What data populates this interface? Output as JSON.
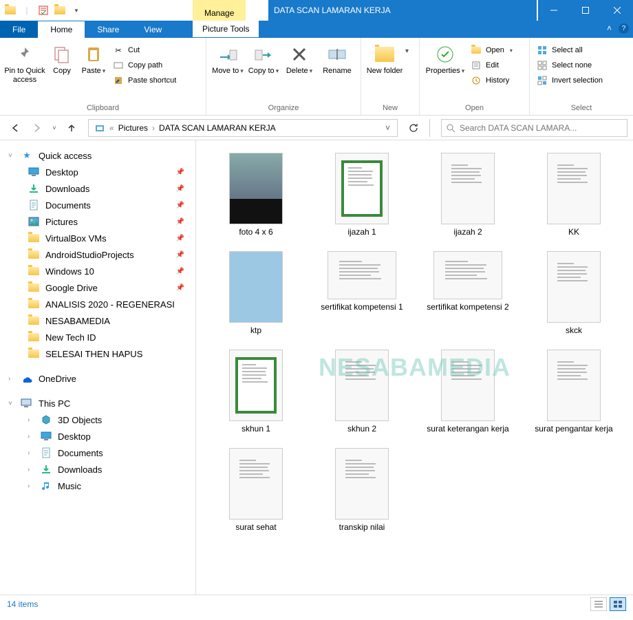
{
  "window": {
    "title": "DATA SCAN LAMARAN KERJA",
    "manage_tab": "Manage",
    "picture_tools": "Picture Tools"
  },
  "tabs": {
    "file": "File",
    "home": "Home",
    "share": "Share",
    "view": "View"
  },
  "ribbon": {
    "clipboard": {
      "label": "Clipboard",
      "pin": "Pin to Quick access",
      "copy": "Copy",
      "paste": "Paste",
      "cut": "Cut",
      "copy_path": "Copy path",
      "paste_shortcut": "Paste shortcut"
    },
    "organize": {
      "label": "Organize",
      "move_to": "Move to",
      "copy_to": "Copy to",
      "delete": "Delete",
      "rename": "Rename"
    },
    "new": {
      "label": "New",
      "new_folder": "New folder"
    },
    "open": {
      "label": "Open",
      "properties": "Properties",
      "open": "Open",
      "edit": "Edit",
      "history": "History"
    },
    "select": {
      "label": "Select",
      "select_all": "Select all",
      "select_none": "Select none",
      "invert": "Invert selection"
    }
  },
  "breadcrumb": {
    "pictures": "Pictures",
    "folder": "DATA SCAN LAMARAN KERJA"
  },
  "search": {
    "placeholder": "Search DATA SCAN LAMARA..."
  },
  "nav": {
    "quick_access": "Quick access",
    "quick_items": [
      {
        "label": "Desktop",
        "pinned": true,
        "icon": "desktop"
      },
      {
        "label": "Downloads",
        "pinned": true,
        "icon": "download"
      },
      {
        "label": "Documents",
        "pinned": true,
        "icon": "document"
      },
      {
        "label": "Pictures",
        "pinned": true,
        "icon": "picture"
      },
      {
        "label": "VirtualBox VMs",
        "pinned": true,
        "icon": "folder"
      },
      {
        "label": "AndroidStudioProjects",
        "pinned": true,
        "icon": "folder"
      },
      {
        "label": "Windows 10",
        "pinned": true,
        "icon": "folder"
      },
      {
        "label": "Google Drive",
        "pinned": true,
        "icon": "folder"
      },
      {
        "label": "ANALISIS 2020 - REGENERASI",
        "pinned": false,
        "icon": "folder"
      },
      {
        "label": "NESABAMEDIA",
        "pinned": false,
        "icon": "folder"
      },
      {
        "label": "New Tech ID",
        "pinned": false,
        "icon": "folder"
      },
      {
        "label": "SELESAI THEN HAPUS",
        "pinned": false,
        "icon": "folder"
      }
    ],
    "onedrive": "OneDrive",
    "this_pc": "This PC",
    "pc_items": [
      {
        "label": "3D Objects",
        "icon": "3d"
      },
      {
        "label": "Desktop",
        "icon": "desktop"
      },
      {
        "label": "Documents",
        "icon": "document"
      },
      {
        "label": "Downloads",
        "icon": "download"
      },
      {
        "label": "Music",
        "icon": "music"
      }
    ]
  },
  "files": [
    {
      "name": "foto 4 x 6",
      "kind": "photo"
    },
    {
      "name": "ijazah 1",
      "kind": "cert"
    },
    {
      "name": "ijazah 2",
      "kind": "doc"
    },
    {
      "name": "KK",
      "kind": "doc"
    },
    {
      "name": "ktp",
      "kind": "id"
    },
    {
      "name": "sertifikat kompetensi 1",
      "kind": "wide"
    },
    {
      "name": "sertifikat kompetensi 2",
      "kind": "wide"
    },
    {
      "name": "skck",
      "kind": "doc"
    },
    {
      "name": "skhun 1",
      "kind": "cert"
    },
    {
      "name": "skhun 2",
      "kind": "doc"
    },
    {
      "name": "surat keterangan kerja",
      "kind": "doc"
    },
    {
      "name": "surat pengantar kerja",
      "kind": "doc"
    },
    {
      "name": "surat sehat",
      "kind": "doc"
    },
    {
      "name": "transkip nilai",
      "kind": "doc"
    }
  ],
  "status": {
    "count": "14 items"
  },
  "watermark": "NESABAMEDIA"
}
